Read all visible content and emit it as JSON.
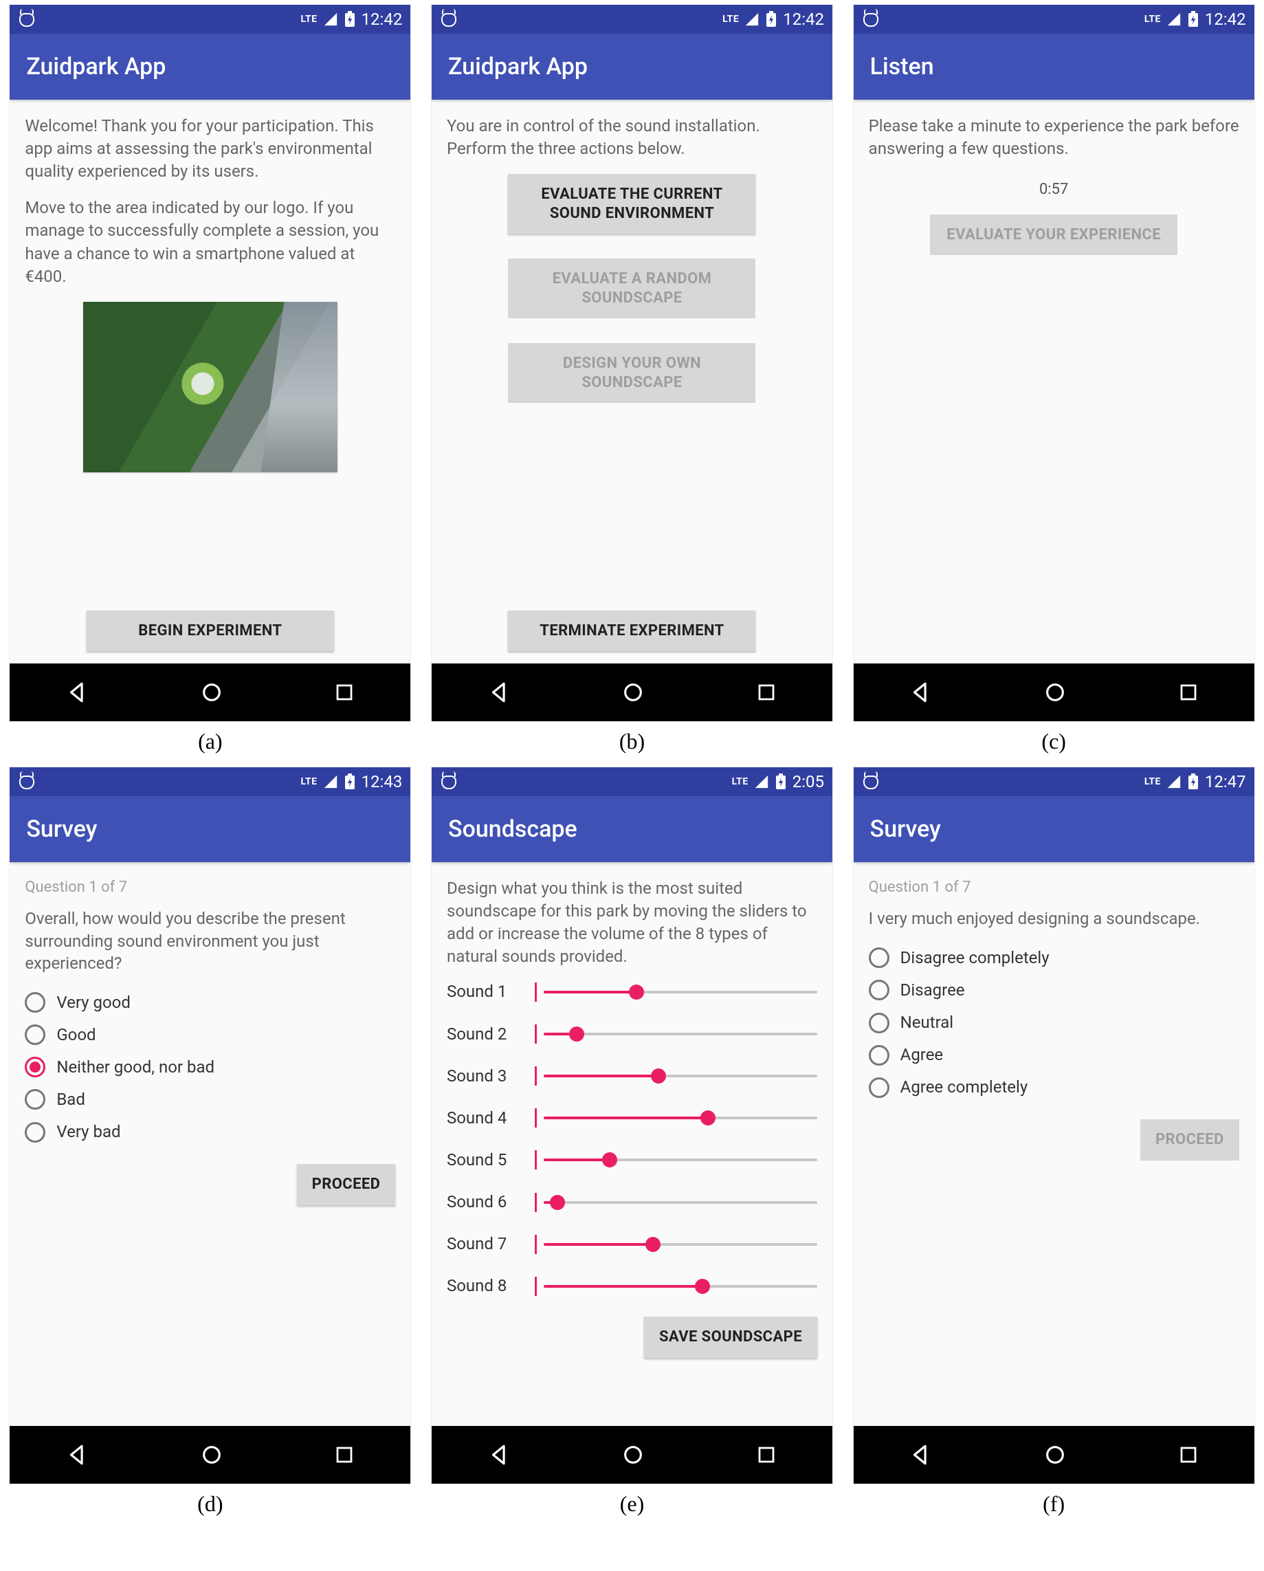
{
  "status": {
    "network": "LTE",
    "battery_icon": "battery-charging"
  },
  "phones": [
    {
      "id": "a",
      "caption": "(a)",
      "time": "12:42",
      "title": "Zuidpark App",
      "intro1": "Welcome! Thank you for your participation. This app aims at assessing the park's environmental quality experienced by its users.",
      "intro2": "Move to the area indicated by our logo. If you manage to successfully complete a session, you have a chance to win a smartphone valued at €400.",
      "begin_btn": "BEGIN EXPERIMENT"
    },
    {
      "id": "b",
      "caption": "(b)",
      "time": "12:42",
      "title": "Zuidpark App",
      "intro": "You are in control of the sound installation. Perform the three actions below.",
      "btn1": "EVALUATE THE CURRENT SOUND ENVIRONMENT",
      "btn2": "EVALUATE A RANDOM SOUNDSCAPE",
      "btn3": "DESIGN YOUR OWN SOUNDSCAPE",
      "terminate_btn": "TERMINATE EXPERIMENT"
    },
    {
      "id": "c",
      "caption": "(c)",
      "time": "12:42",
      "title": "Listen",
      "intro": "Please take a minute to experience the park before answering a few questions.",
      "timer": "0:57",
      "eval_btn": "EVALUATE YOUR EXPERIENCE"
    },
    {
      "id": "d",
      "caption": "(d)",
      "time": "12:43",
      "title": "Survey",
      "qhead": "Question 1 of 7",
      "qtext": "Overall, how would you describe the present surrounding sound environment you just experienced?",
      "options": [
        "Very good",
        "Good",
        "Neither good, nor bad",
        "Bad",
        "Very bad"
      ],
      "selected": 2,
      "proceed_btn": "PROCEED"
    },
    {
      "id": "e",
      "caption": "(e)",
      "time": "2:05",
      "title": "Soundscape",
      "intro": "Design what you think is the most suited soundscape for this park by moving the sliders to add or increase the volume of the 8 types of natural sounds provided.",
      "sliders": [
        {
          "label": "Sound 1",
          "value": 34
        },
        {
          "label": "Sound 2",
          "value": 12
        },
        {
          "label": "Sound 3",
          "value": 42
        },
        {
          "label": "Sound 4",
          "value": 60
        },
        {
          "label": "Sound 5",
          "value": 24
        },
        {
          "label": "Sound 6",
          "value": 5
        },
        {
          "label": "Sound 7",
          "value": 40
        },
        {
          "label": "Sound 8",
          "value": 58
        }
      ],
      "save_btn": "SAVE SOUNDSCAPE"
    },
    {
      "id": "f",
      "caption": "(f)",
      "time": "12:47",
      "title": "Survey",
      "qhead": "Question 1 of 7",
      "qtext": "I very much enjoyed designing a soundscape.",
      "options": [
        "Disagree completely",
        "Disagree",
        "Neutral",
        "Agree",
        "Agree completely"
      ],
      "selected": -1,
      "proceed_btn": "PROCEED"
    }
  ]
}
